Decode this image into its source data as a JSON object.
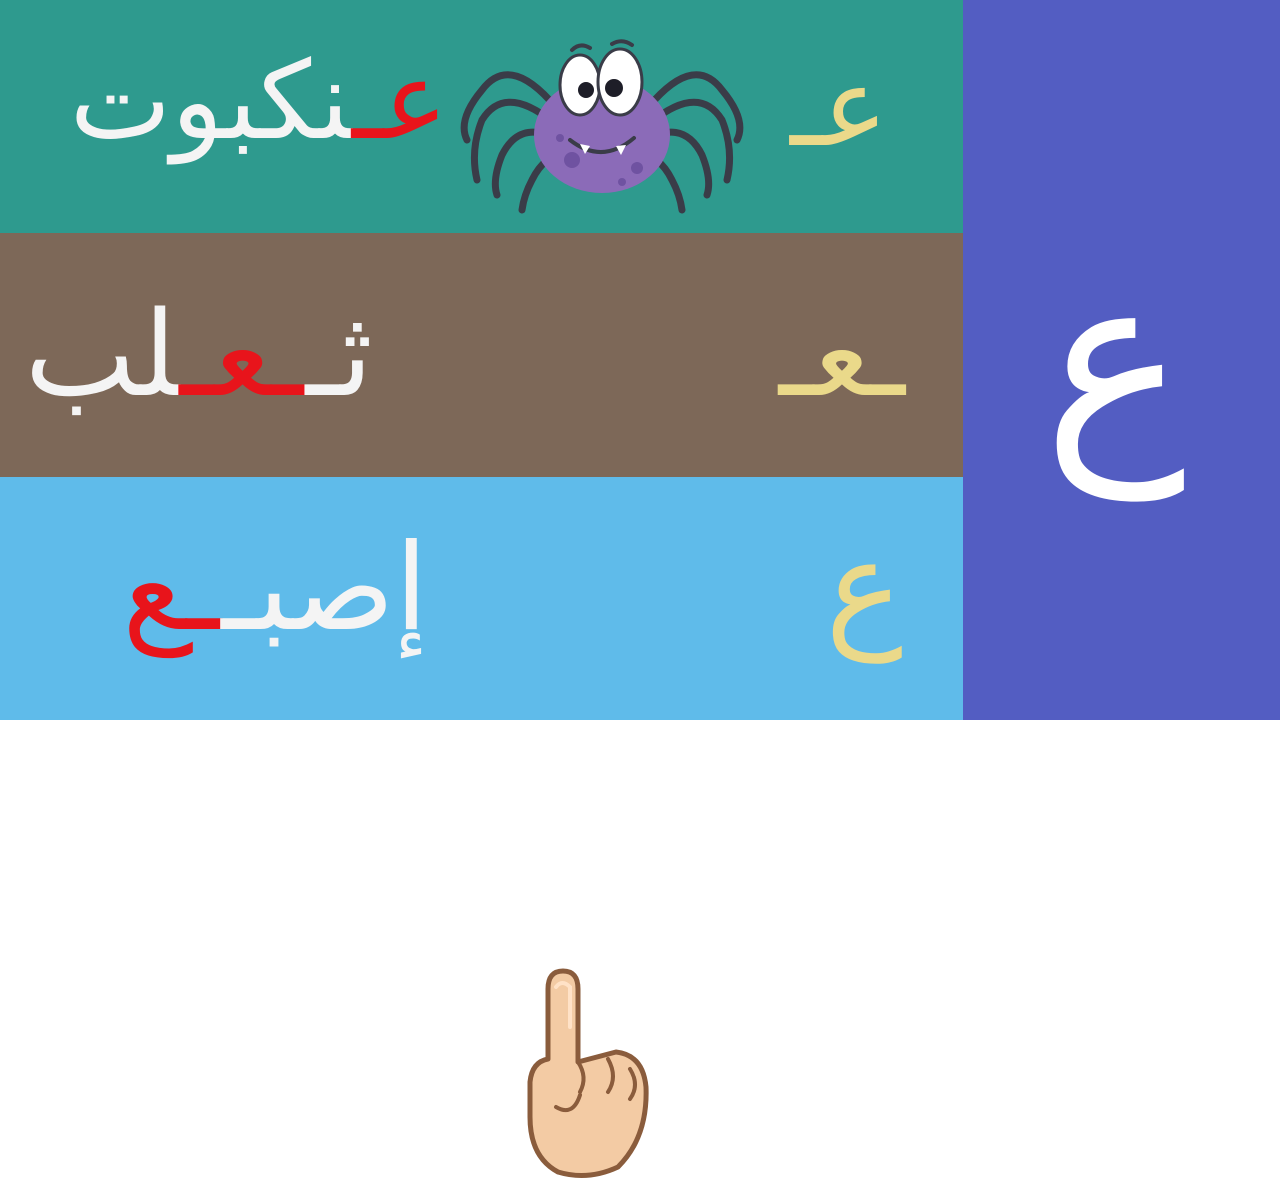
{
  "colors": {
    "row1_bg": "#2e9a8e",
    "row2_bg": "#7d6858",
    "row3_bg": "#5fbbea",
    "side_bg": "#535dc2",
    "word_text": "#f4f4f4",
    "highlight": "#e8141b",
    "letter_form": "#ead98a"
  },
  "side": {
    "letter": "ع"
  },
  "rows": [
    {
      "form": "عـ",
      "word_before": "",
      "word_highlight": "عـ",
      "word_after": "نكبوت",
      "icon": "spider-icon"
    },
    {
      "form": "ـعـ",
      "word_before": "ثـ",
      "word_highlight": "ـعـ",
      "word_after": "لب",
      "icon": "fox-icon"
    },
    {
      "form": "ع",
      "word_before": "إصبـ",
      "word_highlight": "ـع",
      "word_after": "",
      "icon": "pointing-finger-icon"
    }
  ]
}
